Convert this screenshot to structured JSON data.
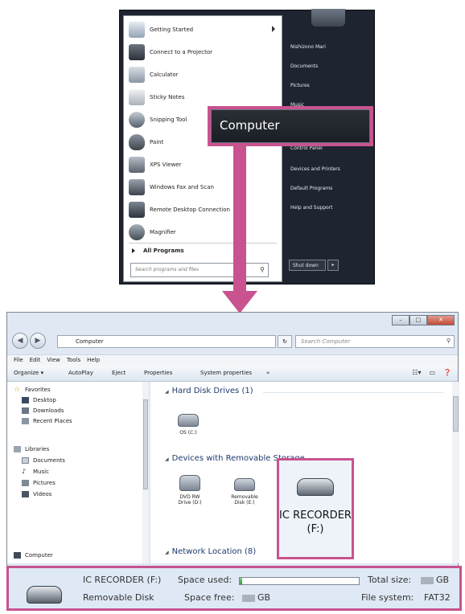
{
  "start_menu": {
    "programs": [
      {
        "label": "Getting Started",
        "icon": "getting-started-icon",
        "submenu": true
      },
      {
        "label": "Connect to a Projector",
        "icon": "projector-icon"
      },
      {
        "label": "Calculator",
        "icon": "calculator-icon"
      },
      {
        "label": "Sticky Notes",
        "icon": "sticky-notes-icon"
      },
      {
        "label": "Snipping Tool",
        "icon": "snipping-tool-icon"
      },
      {
        "label": "Paint",
        "icon": "paint-icon"
      },
      {
        "label": "XPS Viewer",
        "icon": "xps-viewer-icon"
      },
      {
        "label": "Windows Fax and Scan",
        "icon": "fax-scan-icon"
      },
      {
        "label": "Remote Desktop Connection",
        "icon": "remote-desktop-icon"
      },
      {
        "label": "Magnifier",
        "icon": "magnifier-icon"
      }
    ],
    "all_programs": "All Programs",
    "search_placeholder": "Search programs and files",
    "right_items": [
      "Nishizono Mari",
      "Documents",
      "Pictures",
      "Music",
      "Computer",
      "Control Panel",
      "Devices and Printers",
      "Default Programs",
      "Help and Support"
    ],
    "shutdown": "Shut down"
  },
  "computer_callout": {
    "label": "Computer"
  },
  "explorer": {
    "address": "Computer",
    "search_placeholder": "Search Computer",
    "menu": [
      "File",
      "Edit",
      "View",
      "Tools",
      "Help"
    ],
    "toolbar": [
      "Organize ▾",
      "AutoPlay",
      "Eject",
      "Properties",
      "System properties",
      "»"
    ],
    "nav": {
      "favorites": "Favorites",
      "favorites_items": [
        "Desktop",
        "Downloads",
        "Recent Places"
      ],
      "libraries": "Libraries",
      "libraries_items": [
        "Documents",
        "Music",
        "Pictures",
        "Videos"
      ],
      "computer": "Computer"
    },
    "groups": {
      "hard_disk": "Hard Disk Drives (1)",
      "removable": "Devices with Removable Storage",
      "network": "Network Location (8)"
    },
    "drives": {
      "os": "OS (C:)",
      "dvd": "DVD RW Drive (D:)",
      "removable": "Removable Disk (E:)"
    },
    "ic_recorder": "IC RECORDER (F:)"
  },
  "details": {
    "name": "IC RECORDER (F:)",
    "type": "Removable Disk",
    "space_used_label": "Space used:",
    "space_free_label": "Space free:",
    "space_free_value": "GB",
    "total_size_label": "Total size:",
    "total_size_value": "GB",
    "file_system_label": "File system:",
    "file_system_value": "FAT32",
    "used_fraction": 0.02
  }
}
